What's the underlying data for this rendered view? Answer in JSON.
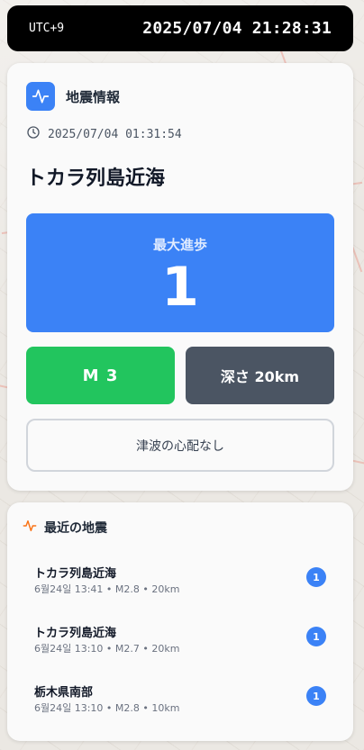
{
  "header": {
    "timezone": "UTC+9",
    "datetime": "2025/07/04 21:28:31"
  },
  "info": {
    "title": "地震情報",
    "icon": "pulse-icon",
    "time": "2025/07/04 01:31:54",
    "location": "トカラ列島近海",
    "intensity_label": "最大進歩",
    "intensity_value": "1",
    "magnitude": "M 3",
    "depth": "深さ 20km",
    "tsunami": "津波の心配なし"
  },
  "recent": {
    "title": "最近の地震",
    "items": [
      {
        "name": "トカラ列島近海",
        "meta": "6월24일 13:41 • M2.8 • 20km",
        "intensity": "1"
      },
      {
        "name": "トカラ列島近海",
        "meta": "6월24일 13:10 • M2.7 • 20km",
        "intensity": "1"
      },
      {
        "name": "栃木県南部",
        "meta": "6월24일 13:10 • M2.8 • 10km",
        "intensity": "1"
      }
    ]
  },
  "colors": {
    "accent": "#3b82f6",
    "magnitude": "#22c55e",
    "depth": "#4b5563",
    "recent_icon": "#f97316"
  }
}
